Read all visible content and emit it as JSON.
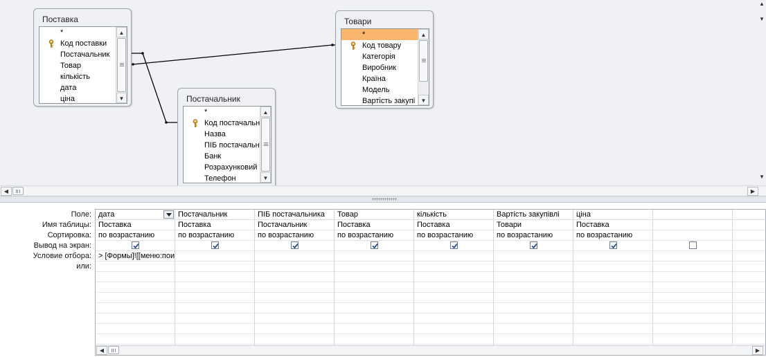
{
  "tables": {
    "postavka": {
      "title": "Поставка",
      "fields": [
        "*",
        "Код поставки",
        "Постачальник",
        "Товар",
        "кількість",
        "дата",
        "ціна"
      ]
    },
    "tovary": {
      "title": "Товари",
      "fields": [
        "*",
        "Код товару",
        "Категорія",
        "Виробник",
        "Країна",
        "Модель",
        "Вартість закупі"
      ]
    },
    "postachalnyk": {
      "title": "Постачальник",
      "fields": [
        "*",
        "Код постачальн",
        "Назва",
        "ПІБ постачальн",
        "Банк",
        "Розрахунковий",
        "Телефон"
      ]
    }
  },
  "row_labels": {
    "field": "Поле:",
    "table": "Имя таблицы:",
    "sort": "Сортировка:",
    "show": "Вывод на экран:",
    "criteria": "Условие отбора:",
    "or": "или:"
  },
  "columns": [
    {
      "field": "дата",
      "table": "Поставка",
      "sort": "по возрастанию",
      "show": true,
      "criteria": "> [Формы]![[меню:пои"
    },
    {
      "field": "Постачальник",
      "table": "Поставка",
      "sort": "по возрастанию",
      "show": true,
      "criteria": ""
    },
    {
      "field": "ПІБ постачальника",
      "table": "Постачальник",
      "sort": "по возрастанию",
      "show": true,
      "criteria": ""
    },
    {
      "field": "Товар",
      "table": "Поставка",
      "sort": "по возрастанию",
      "show": true,
      "criteria": ""
    },
    {
      "field": "кількість",
      "table": "Поставка",
      "sort": "по возрастанию",
      "show": true,
      "criteria": ""
    },
    {
      "field": "Вартість закупівлі",
      "table": "Товари",
      "sort": "по возрастанию",
      "show": true,
      "criteria": ""
    },
    {
      "field": "ціна",
      "table": "Поставка",
      "sort": "по возрастанию",
      "show": true,
      "criteria": ""
    },
    {
      "field": "",
      "table": "",
      "sort": "",
      "show": false,
      "criteria": ""
    },
    {
      "field": "",
      "table": "",
      "sort": "",
      "show": null,
      "criteria": ""
    }
  ],
  "colors": {
    "selected_field": "#f8b56b",
    "diagram_bg": "#f0f1f4",
    "check": "#2b4f8c"
  }
}
